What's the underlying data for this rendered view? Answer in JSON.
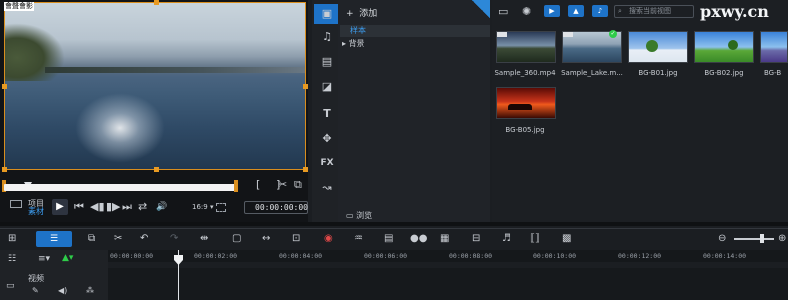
{
  "preview": {
    "project_label": "项目",
    "clip_label": "素材",
    "timecode": "00:00:00:00",
    "aspect_ratio": "16:9",
    "logo_text": "會聲會影",
    "icons": {
      "play": "▶",
      "prev": "⏮",
      "stepback": "◀▮",
      "stepfwd": "▮▶",
      "next": "⏭",
      "loop": "⇄",
      "volume": "🔊",
      "mark_in": "[",
      "mark_out": "]",
      "split": "✂",
      "snapshot": "⧉"
    }
  },
  "sidebar": {
    "items": [
      "media-icon",
      "audio-icon",
      "instant-project-icon",
      "title-template-icon",
      "text-icon",
      "transition-icon",
      "fx-icon",
      "path-icon"
    ],
    "fx_label": "FX",
    "text_label": "T"
  },
  "folders": {
    "add_label": "添加",
    "items": [
      {
        "label": "样本",
        "selected": true
      },
      {
        "label": "背景",
        "selected": false
      }
    ],
    "browse_label": "浏览"
  },
  "library": {
    "search_placeholder": "搜索当前视图",
    "watermark": "pxwy.cn",
    "items": [
      {
        "label": "Sample_360.mp4",
        "kind": "video"
      },
      {
        "label": "Sample_Lake.m...",
        "kind": "video"
      },
      {
        "label": "BG-B01.jpg",
        "kind": "image"
      },
      {
        "label": "BG-B02.jpg",
        "kind": "image"
      },
      {
        "label": "BG-B",
        "kind": "image"
      },
      {
        "label": "BG-B05.jpg",
        "kind": "image"
      }
    ]
  },
  "timeline": {
    "ruler": [
      "00:00:00:00",
      "00:00:02:00",
      "00:00:04:00",
      "00:00:06:00",
      "00:00:08:00",
      "00:00:10:00",
      "00:00:12:00",
      "00:00:14:00"
    ],
    "track_name": "视频",
    "tools": [
      "storyboard-view-icon",
      "timeline-view-icon",
      "copy-icon",
      "scissors-icon",
      "undo-icon",
      "redo-icon",
      "trim-icon",
      "crop-icon",
      "stretch-icon",
      "motion-icon",
      "color-icon",
      "audio-wave-icon",
      "subtitle-icon",
      "mask-icon",
      "title-icon",
      "grid-icon",
      "music-icon",
      "speed-icon",
      "record-icon"
    ],
    "colors": {
      "accent": "#1e73c8",
      "trim": "#d98e1e",
      "add_track": "#2fcc4a"
    }
  }
}
